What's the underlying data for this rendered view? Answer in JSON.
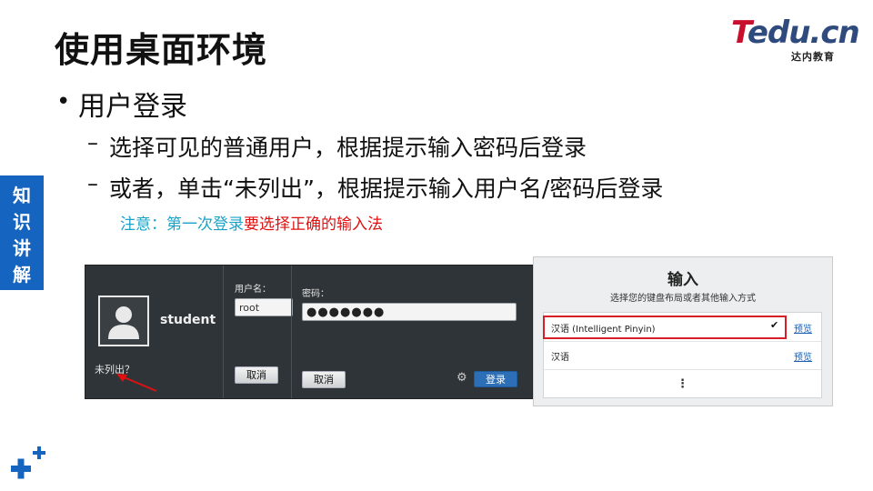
{
  "slide": {
    "title": "使用桌面环境",
    "logo": {
      "main_t": "T",
      "main_rest": "edu.cn",
      "sub": "达内教育"
    },
    "side_tab": [
      "知",
      "识",
      "讲",
      "解"
    ],
    "bullet_1": "用户登录",
    "sub_bullets": [
      "选择可见的普通用户，根据提示输入密码后登录",
      "或者，单击“未列出”，根据提示输入用户名/密码后登录"
    ],
    "note_part1": "注意：第一次登录",
    "note_part2": "要选择正确的输入法"
  },
  "login_screen": {
    "username": "student",
    "not_listed": "未列出？",
    "username_label": "用户名：",
    "username_value": "root",
    "cancel_label": "取消",
    "password_label": "密码：",
    "password_value": "●●●●●●●",
    "login_label": "登录"
  },
  "input_panel": {
    "title": "输入",
    "subtitle": "选择您的键盘布局或者其他输入方式",
    "options": [
      {
        "name": "汉语 (Intelligent Pinyin)",
        "link": "预览"
      },
      {
        "name": "汉语",
        "link": "预览"
      }
    ],
    "more": "⋮"
  },
  "colors": {
    "accent": "#1565c0",
    "note_cyan": "#1aa3c8",
    "note_red": "#e01010",
    "highlight_box": "#d61f26"
  },
  "icons": [
    "user-avatar-icon",
    "gear-icon",
    "checkmark-icon",
    "more-vertical-icon",
    "red-arrow-icon",
    "plus-logo-icon"
  ]
}
